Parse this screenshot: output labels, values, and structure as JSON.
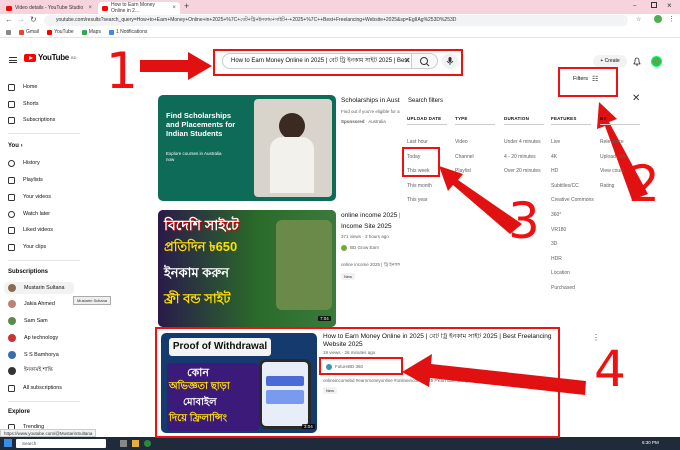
{
  "browser": {
    "tabs": [
      {
        "label": "Video details - YouTube Studio",
        "active": false
      },
      {
        "label": "How to Earn Money Online in 2...",
        "active": true
      }
    ],
    "new_tab": "+",
    "url": "youtube.com/results?search_query=How+to+Earn+Money+Online+in+2025+%7C+বেট+ট্রি+ইনকাম+সাইট+-+2025+%7C++Best+Freelancing+Website+2025&sp=EgIIAg%253D%253D",
    "bookmarks": [
      "Gmail",
      "YouTube",
      "Maps",
      "1 Notifications"
    ]
  },
  "header": {
    "logo": "YouTube",
    "country": "BD",
    "search_value": "How to Earn Money Online in 2025 | বেট ট্রি ইনকাম সাইট  2025 | Best",
    "create_label": "Create"
  },
  "sidebar": {
    "top": [
      {
        "label": "Home",
        "icon": "home-icon"
      },
      {
        "label": "Shorts",
        "icon": "shorts-icon"
      },
      {
        "label": "Subscriptions",
        "icon": "subscriptions-icon"
      }
    ],
    "you_heading": "You",
    "you_items": [
      {
        "label": "History",
        "icon": "history-icon"
      },
      {
        "label": "Playlists",
        "icon": "playlists-icon"
      },
      {
        "label": "Your videos",
        "icon": "your-videos-icon"
      },
      {
        "label": "Watch later",
        "icon": "watch-later-icon"
      },
      {
        "label": "Liked videos",
        "icon": "liked-videos-icon"
      },
      {
        "label": "Your clips",
        "icon": "clips-icon"
      }
    ],
    "subs_heading": "Subscriptions",
    "subs": [
      {
        "label": "Mustarin Sultana",
        "color": "#8a6a50"
      },
      {
        "label": "Jakia Ahmed",
        "color": "#c08070"
      },
      {
        "label": "Sam Sam",
        "color": "#5a8a4a"
      },
      {
        "label": "Ap technology",
        "color": "#c33"
      },
      {
        "label": "S S Bamhorya",
        "color": "#3a6ab0"
      },
      {
        "label": "ইনকামই শান্তি",
        "color": "#333"
      },
      {
        "label": "All subscriptions",
        "color": "#fff"
      }
    ],
    "tooltip": "Mustarin Sultana",
    "explore_heading": "Explore",
    "trending": "Trending"
  },
  "results": [
    {
      "title": "Scholarships in Austra",
      "meta1": "Find out if you're eligible for a sch",
      "sponsored": "Sponsored",
      "sponsor_name": "Australia",
      "thumb_heading": "Find Scholarships and Placements for Indian Students",
      "thumb_sub": "Explore courses in Australia now"
    },
    {
      "title": "online income 2025 | ",
      "title2": "Income Site 2025",
      "meta1": "371 views · 3 hours ago",
      "channel": "BD Grow Earn",
      "desc": "online income 2025 | ট্রি ইনকাম",
      "badge": "New",
      "duration": "7:04",
      "thumb_lines": [
        "বিদেশি সাইটে",
        "প্রতিদিন ৳650",
        "ইনকাম করুন",
        "ফ্রী বন্ড সাইট"
      ]
    },
    {
      "title": "How to Earn Money Online in 2025 | বেট ট্রি ইনকাম সাইট 2025 | Best Freelancing",
      "title2": "Website 2025",
      "meta1": "19 views · 26 minutes ago",
      "channel": "FutureBD 360",
      "desc": "onlineincomebd #earnmoneyonline #onlineincome2025 #YouTuber Bangla earn money",
      "badge": "New",
      "duration": "3:04",
      "thumb_banner": "Proof of Withdrawal",
      "thumb_lines": [
        "কোন",
        "অভিজ্ঞতা ছাড়া",
        "মোবাইল",
        "দিয়ে ফ্রিলান্সিং"
      ]
    }
  ],
  "filters": {
    "title": "Search filters",
    "button_label": "Filters",
    "columns": [
      {
        "heading": "UPLOAD DATE",
        "options": [
          "Last hour",
          "Today",
          "This week",
          "This month",
          "This year"
        ]
      },
      {
        "heading": "TYPE",
        "options": [
          "Video",
          "Channel",
          "Playlist"
        ]
      },
      {
        "heading": "DURATION",
        "options": [
          "Under 4 minutes",
          "4 - 20 minutes",
          "Over 20 minutes"
        ]
      },
      {
        "heading": "FEATURES",
        "options": [
          "Live",
          "4K",
          "HD",
          "Subtitles/CC",
          "Creative Commons",
          "360°",
          "VR180",
          "3D",
          "HDR",
          "Location",
          "Purchased"
        ]
      },
      {
        "heading": "BY",
        "options": [
          "Relevance",
          "Upload date",
          "View count",
          "Rating"
        ]
      }
    ]
  },
  "annotations": {
    "labels": [
      "1",
      "2",
      "3",
      "4"
    ],
    "color": "#e11111"
  },
  "statusbar": {
    "hover_url": "https://www.youtube.com/@MustarinSultana"
  },
  "taskbar": {
    "search_placeholder": "Search",
    "time": "6:30 PM"
  }
}
